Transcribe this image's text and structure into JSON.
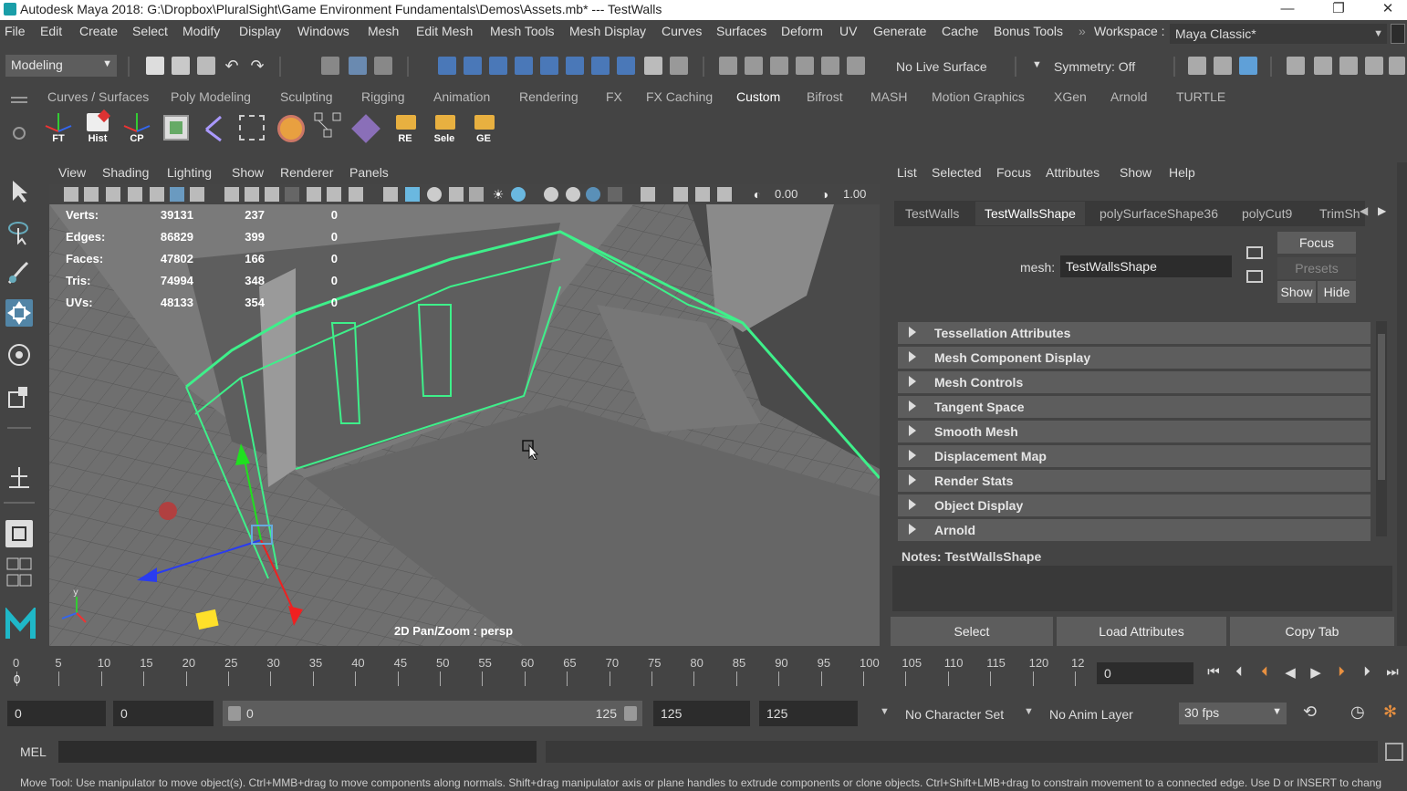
{
  "title_bar": {
    "title": "Autodesk Maya 2018: G:\\Dropbox\\PluralSight\\Game Environment Fundamentals\\Demos\\Assets.mb*   ---   TestWalls",
    "minimize": "—",
    "restore": "❐",
    "close": "✕"
  },
  "menu": [
    "File",
    "Edit",
    "Create",
    "Select",
    "Modify",
    "Display",
    "Windows",
    "Mesh",
    "Edit Mesh",
    "Mesh Tools",
    "Mesh Display",
    "Curves",
    "Surfaces",
    "Deform",
    "UV",
    "Generate",
    "Cache",
    "Bonus Tools"
  ],
  "workspace": {
    "label": "Workspace :",
    "value": "Maya Classic*"
  },
  "status_line": {
    "menuset": "Modeling",
    "live_surface": "No Live Surface",
    "symmetry": "Symmetry: Off"
  },
  "shelf_tabs": [
    "Curves / Surfaces",
    "Poly Modeling",
    "Sculpting",
    "Rigging",
    "Animation",
    "Rendering",
    "FX",
    "FX Caching",
    "Custom",
    "Bifrost",
    "MASH",
    "Motion Graphics",
    "XGen",
    "Arnold",
    "TURTLE"
  ],
  "shelf_active": "Custom",
  "shelf_icons": [
    "FT",
    "Hist",
    "CP",
    "",
    "",
    "",
    "",
    "",
    "",
    "RE",
    "Sele",
    "GE"
  ],
  "viewport_menu": [
    "View",
    "Shading",
    "Lighting",
    "Show",
    "Renderer",
    "Panels"
  ],
  "viewport_fields": {
    "exposure": "0.00",
    "gamma": "1.00"
  },
  "hud": {
    "rows": [
      {
        "label": "Verts:",
        "a": "39131",
        "b": "237",
        "c": "0"
      },
      {
        "label": "Edges:",
        "a": "86829",
        "b": "399",
        "c": "0"
      },
      {
        "label": "Faces:",
        "a": "47802",
        "b": "166",
        "c": "0"
      },
      {
        "label": "Tris:",
        "a": "74994",
        "b": "348",
        "c": "0"
      },
      {
        "label": "UVs:",
        "a": "48133",
        "b": "354",
        "c": "0"
      }
    ],
    "camera": "2D Pan/Zoom : persp"
  },
  "attribute_editor": {
    "menu": [
      "List",
      "Selected",
      "Focus",
      "Attributes",
      "Show",
      "Help"
    ],
    "tabs": [
      "TestWalls",
      "TestWallsShape",
      "polySurfaceShape36",
      "polyCut9",
      "TrimSh"
    ],
    "active_tab": "TestWallsShape",
    "mesh_label": "mesh:",
    "mesh_value": "TestWallsShape",
    "focus": "Focus",
    "presets": "Presets",
    "show": "Show",
    "hide": "Hide",
    "sections": [
      "Tessellation Attributes",
      "Mesh Component Display",
      "Mesh Controls",
      "Tangent Space",
      "Smooth Mesh",
      "Displacement Map",
      "Render Stats",
      "Object Display",
      "Arnold"
    ],
    "notes_label": "Notes:  TestWallsShape",
    "buttons": [
      "Select",
      "Load Attributes",
      "Copy Tab"
    ]
  },
  "time_slider": {
    "ticks": [
      "0",
      "5",
      "10",
      "15",
      "20",
      "25",
      "30",
      "35",
      "40",
      "45",
      "50",
      "55",
      "60",
      "65",
      "70",
      "75",
      "80",
      "85",
      "90",
      "95",
      "100",
      "105",
      "110",
      "115",
      "120",
      "12"
    ],
    "current_frame_marker": "0",
    "current_frame": "0"
  },
  "range_slider": {
    "start": "0",
    "playback_start": "0",
    "range_start": "0",
    "range_end": "125",
    "playback_end": "125",
    "end": "125",
    "character_set": "No Character Set",
    "anim_layer": "No Anim Layer",
    "fps": "30 fps"
  },
  "command_line": {
    "lang": "MEL"
  },
  "help_line": "Move Tool: Use manipulator to move object(s). Ctrl+MMB+drag to move components along normals. Shift+drag manipulator axis or plane handles to extrude components or clone objects. Ctrl+Shift+LMB+drag to constrain movement to a connected edge. Use D or INSERT to chang"
}
